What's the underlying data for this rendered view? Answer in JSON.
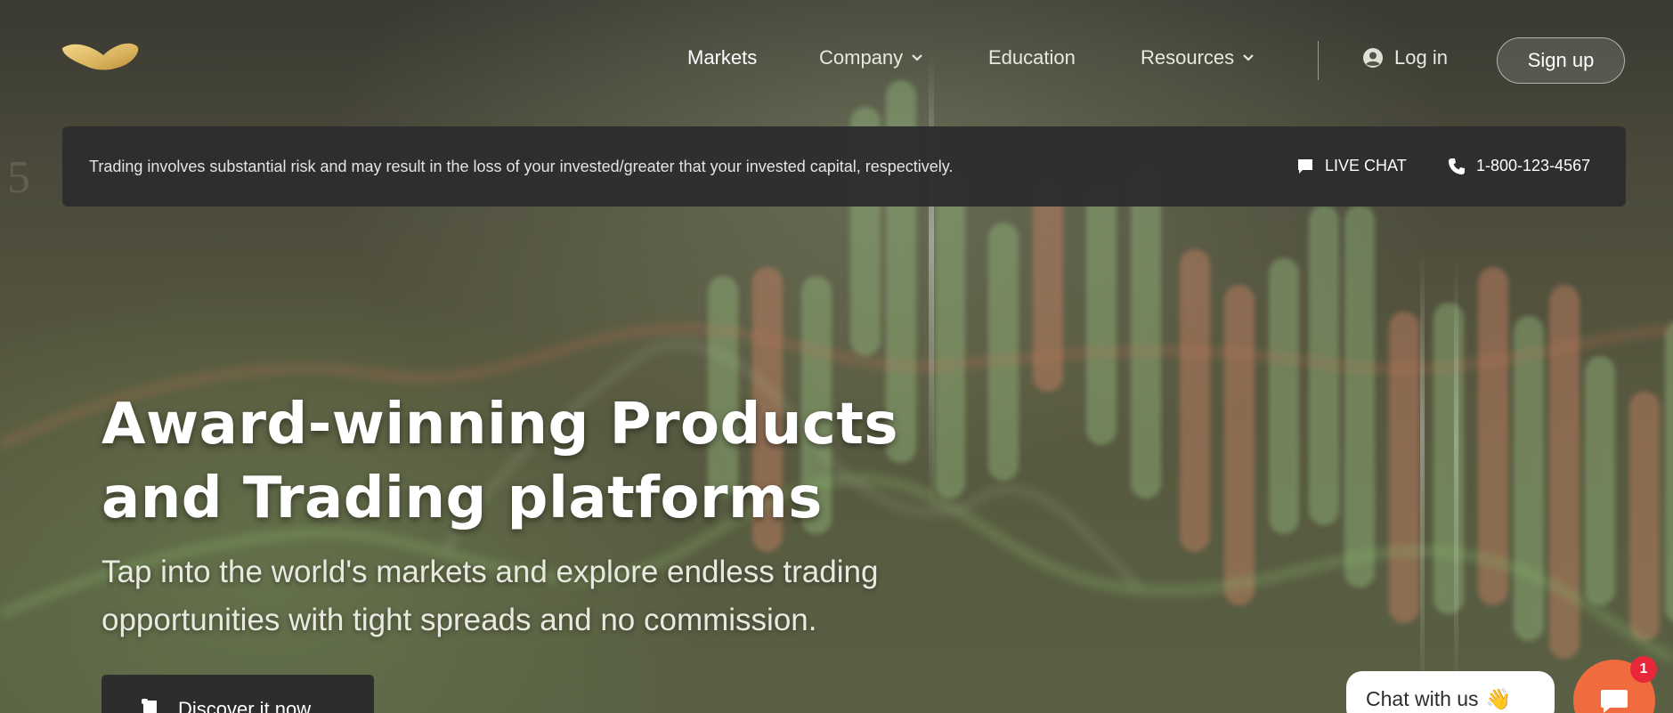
{
  "nav": {
    "items": [
      {
        "label": "Markets",
        "has_dropdown": false,
        "active": true
      },
      {
        "label": "Company",
        "has_dropdown": true,
        "active": false
      },
      {
        "label": "Education",
        "has_dropdown": false,
        "active": false
      },
      {
        "label": "Resources",
        "has_dropdown": true,
        "active": false
      }
    ],
    "login_label": "Log in",
    "signup_label": "Sign up"
  },
  "risk_bar": {
    "text": "Trading involves substantial risk and may result in the loss of your invested/greater that your invested capital, respectively.",
    "live_chat_label": "LIVE CHAT",
    "phone": "1-800-123-4567"
  },
  "background": {
    "digit": "5"
  },
  "hero": {
    "title_line1": "Award-winning Products",
    "title_line2": "and Trading platforms",
    "subtitle_line1": "Tap into the world's markets and explore endless trading",
    "subtitle_line2": "opportunities with tight spreads and no commission.",
    "cta_label": "Discover it now"
  },
  "chat_widget": {
    "bubble_text": "Chat with us",
    "bubble_emoji": "👋",
    "unread_count": "1"
  },
  "colors": {
    "accent_gold": "#d9b25c",
    "chat_orange": "#f06c3f",
    "badge_red": "#e8283a",
    "dark_panel": "#2d2d2d"
  }
}
